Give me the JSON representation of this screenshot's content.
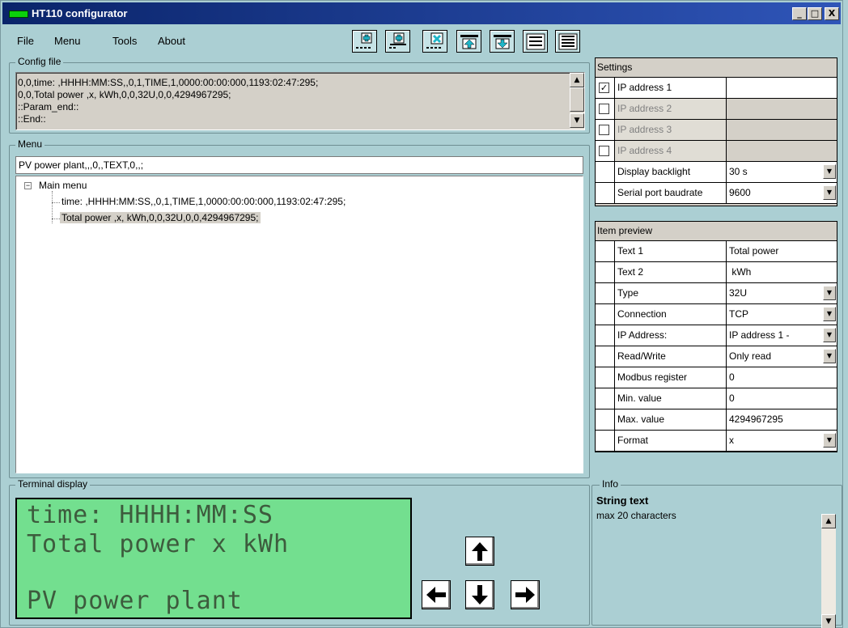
{
  "window": {
    "title": "HT110 configurator",
    "controls": {
      "minimize": "_",
      "maximize": "□",
      "close": "X"
    }
  },
  "menubar": [
    "File",
    "Menu",
    "Tools",
    "About"
  ],
  "toolbar": {
    "buttons": [
      {
        "name": "add-item",
        "icon": "plus-icon"
      },
      {
        "name": "add-subitem",
        "icon": "plus-subitem-icon"
      },
      {
        "name": "delete-item",
        "icon": "x-delete-icon"
      },
      {
        "name": "move-up",
        "icon": "move-up-icon"
      },
      {
        "name": "move-down",
        "icon": "move-down-icon"
      },
      {
        "name": "collapse-all",
        "icon": "list-collapse-icon"
      },
      {
        "name": "expand-all",
        "icon": "list-expand-icon"
      }
    ]
  },
  "config_file": {
    "label": "Config file",
    "lines": [
      "0,0,time: ,HHHH:MM:SS,,0,1,TIME,1,0000:00:00:000,1193:02:47:295;",
      "0,0,Total power ,x, kWh,0,0,32U,0,0,4294967295;",
      "::Param_end::",
      "::End::"
    ]
  },
  "menu": {
    "label": "Menu",
    "input_value": "PV power plant,,,0,,TEXT,0,,;",
    "tree": {
      "root": "Main menu",
      "expander": "−",
      "children": [
        "time: ,HHHH:MM:SS,,0,1,TIME,1,0000:00:00:000,1193:02:47:295;",
        "Total power ,x, kWh,0,0,32U,0,0,4294967295;"
      ],
      "selected_index": 1
    }
  },
  "terminal": {
    "label": "Terminal display",
    "lines": [
      "time: HHHH:MM:SS",
      "Total power x kWh",
      "",
      "PV power plant"
    ]
  },
  "settings": {
    "header": "Settings",
    "rows": [
      {
        "checked": true,
        "label": "IP address 1",
        "value": "",
        "enabled": true
      },
      {
        "checked": false,
        "label": "IP address 2",
        "value": "",
        "enabled": false
      },
      {
        "checked": false,
        "label": "IP address 3",
        "value": "",
        "enabled": false
      },
      {
        "checked": false,
        "label": "IP address 4",
        "value": "",
        "enabled": false
      },
      {
        "label": "Display backlight",
        "value": "30 s",
        "dropdown": true
      },
      {
        "label": "Serial port baudrate",
        "value": "9600",
        "dropdown": true
      }
    ]
  },
  "item_preview": {
    "header": "Item preview",
    "rows": [
      {
        "label": "Text 1",
        "value": "Total power"
      },
      {
        "label": "Text 2",
        "value": " kWh"
      },
      {
        "label": "Type",
        "value": "32U",
        "dropdown": true
      },
      {
        "label": "Connection",
        "value": "TCP",
        "dropdown": true
      },
      {
        "label": "IP Address:",
        "value": "IP address 1 -",
        "dropdown": true
      },
      {
        "label": "Read/Write",
        "value": "Only read",
        "dropdown": true
      },
      {
        "label": "Modbus register",
        "value": "0"
      },
      {
        "label": "Min. value",
        "value": "0"
      },
      {
        "label": "Max. value",
        "value": "4294967295"
      },
      {
        "label": "Format",
        "value": "x",
        "dropdown": true
      }
    ]
  },
  "info": {
    "label": "Info",
    "title": "String text",
    "text": "max 20 characters"
  },
  "colors": {
    "window_bg": "#abcfd3",
    "title_bar": "#0a246a",
    "lcd_bg": "#73df8f",
    "lcd_text": "#3d5b3d",
    "tree_selection": "#d4d0c8"
  }
}
